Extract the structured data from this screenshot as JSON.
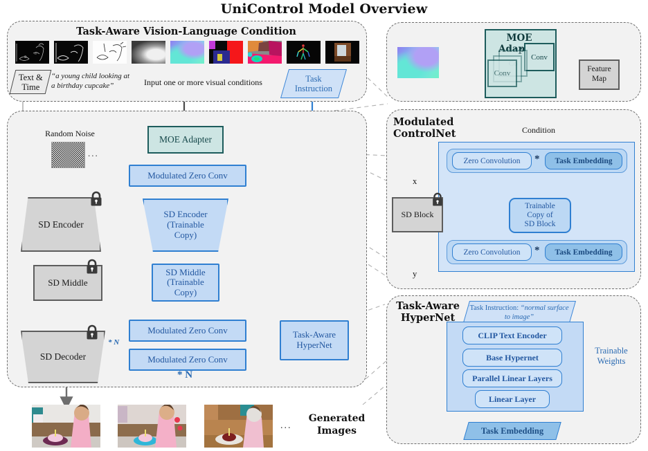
{
  "title": "UniControl Model Overview",
  "panels": {
    "condition": {
      "title": "Task-Aware Vision-Language Condition",
      "text_time": "Text &\nTime",
      "caption": "“a young child looking at\na birthday cupcake”",
      "hint": "Input one or more visual conditions",
      "task_instruction": "Task\nInstruction",
      "thumbnails": [
        {
          "name": "canny-edge-condition"
        },
        {
          "name": "hed-boundary-condition"
        },
        {
          "name": "sketch-condition"
        },
        {
          "name": "depth-map-condition"
        },
        {
          "name": "normal-surface-condition"
        },
        {
          "name": "bounding-box-condition"
        },
        {
          "name": "segmentation-condition"
        },
        {
          "name": "human-pose-condition"
        },
        {
          "name": "outpainting-condition"
        }
      ]
    },
    "moe": {
      "title": "MOE Adapter",
      "conv_front": "Conv",
      "conv_mid": "Co",
      "conv_back": "Conv",
      "dots": "• • •",
      "feature_map": "Feature\nMap"
    },
    "main": {
      "random_noise": "Random Noise",
      "noise_dots": "...",
      "moe_adapter": "MOE Adapter",
      "zero_conv_top": "Modulated Zero Conv",
      "zero_conv_mid": "Modulated Zero Conv",
      "zero_conv_bot": "Modulated Zero Conv",
      "sd_encoder": "SD Encoder",
      "sd_middle": "SD Middle",
      "sd_decoder": "SD Decoder",
      "sd_encoder_copy": "SD Encoder\n(Trainable\nCopy)",
      "sd_middle_copy": "SD Middle\n(Trainable\nCopy)",
      "hypernet": "Task-Aware\nHyperNet",
      "times_n_small": "* N",
      "times_n_big": "* N"
    },
    "controlnet": {
      "title": "Modulated\nControlNet",
      "condition": "Condition",
      "x": "x",
      "y": "y",
      "sd_block": "SD Block",
      "zero_conv_top": "Zero Convolution",
      "zero_conv_bot": "Zero Convolution",
      "task_embedding_top": "Task Embedding",
      "task_embedding_bot": "Task Embedding",
      "multiply": "*",
      "trainable_copy": "Trainable\nCopy of\nSD Block"
    },
    "hypernet": {
      "title": "Task-Aware\nHyperNet",
      "instruction_prefix": "Task Instruction:",
      "instruction_value": "“normal surface to image”",
      "layers": [
        "CLIP Text Encoder",
        "Base Hypernet",
        "Parallel Linear Layers",
        "Linear Layer"
      ],
      "trainable_weights": "Trainable\nWeights",
      "task_embedding": "Task Embedding"
    },
    "output": {
      "dots": "...",
      "label": "Generated\nImages",
      "images": [
        {
          "name": "generated-image-1"
        },
        {
          "name": "generated-image-2"
        },
        {
          "name": "generated-image-3"
        }
      ]
    }
  },
  "colors": {
    "blue_fill": "#c3daf5",
    "blue_stroke": "#2f7fd1",
    "blue_text": "#2257a0",
    "grey_fill": "#d4d4d4",
    "grey_stroke": "#5d5d5d",
    "teal_fill": "#cde5e3",
    "teal_stroke": "#1d5c5c",
    "panel_fill": "#f2f2f2",
    "panel_stroke": "#6d6d6d"
  }
}
